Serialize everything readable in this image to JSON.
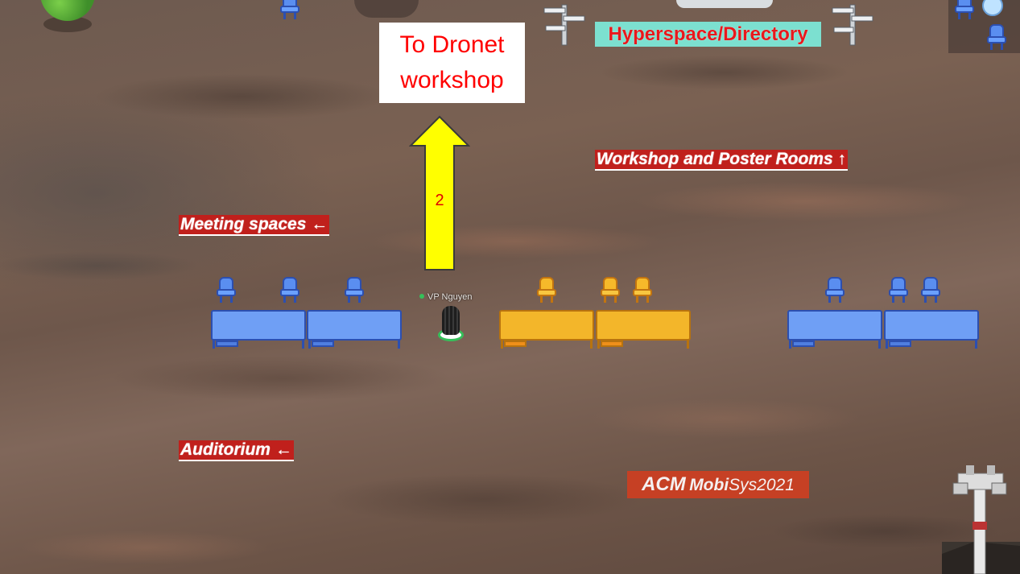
{
  "signs": {
    "dronet": "To Dronet workshop",
    "hyperspace": "Hyperspace/Directory",
    "workshop": "Workshop and Poster Rooms ↑",
    "meeting": "Meeting spaces ←",
    "auditorium": "Auditorium ←",
    "arrow_number": "2"
  },
  "logo": {
    "acm": "ACM",
    "mobi": "Mobi",
    "sys": "Sys2021"
  },
  "player": {
    "name": "VP Nguyen",
    "status_color": "#35c05a"
  },
  "colors": {
    "label_red": "#c0201c",
    "hyperspace_bg": "#7ce0d0",
    "arrow_yellow": "#ffff00",
    "table_blue": "#6f9ff5",
    "table_orange": "#f3b62a"
  }
}
